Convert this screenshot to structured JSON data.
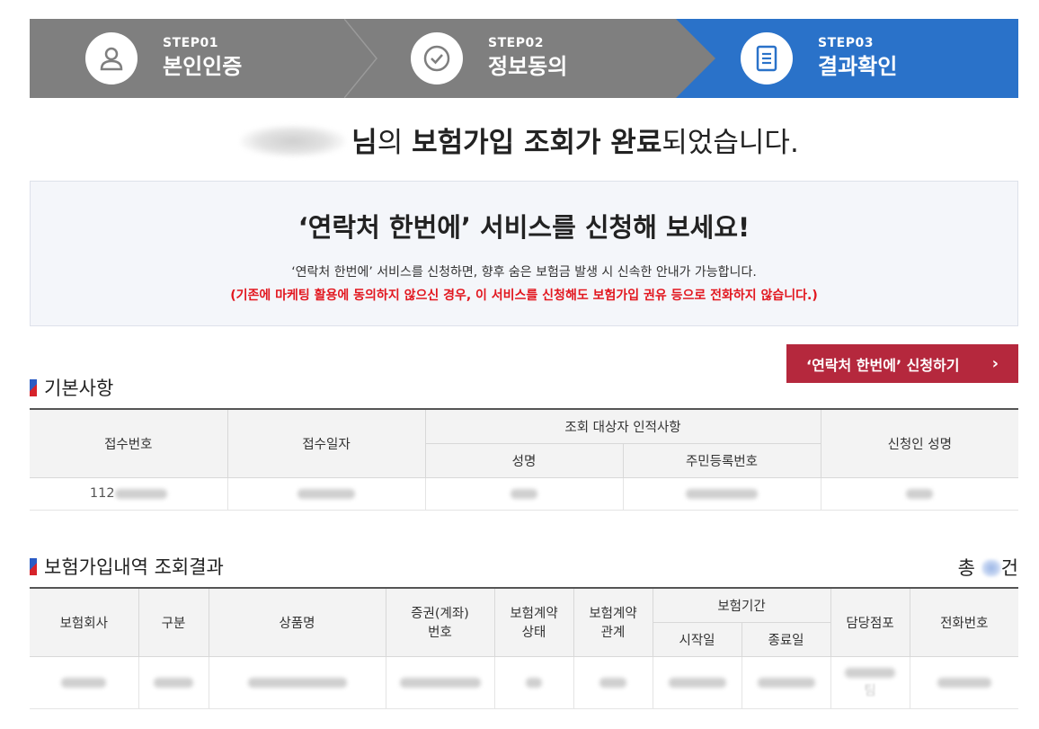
{
  "steps": [
    {
      "no": "STEP01",
      "label": "본인인증",
      "icon": "user-icon",
      "active": false
    },
    {
      "no": "STEP02",
      "label": "정보동의",
      "icon": "check-circle-icon",
      "active": false
    },
    {
      "no": "STEP03",
      "label": "결과확인",
      "icon": "document-icon",
      "active": true
    }
  ],
  "headline": {
    "suffix_1": "님",
    "suffix_2": "의 ",
    "bold": "보험가입 조회가 완료",
    "suffix_3": "되었습니다."
  },
  "banner": {
    "title": "‘연락처 한번에’ 서비스를 신청해 보세요!",
    "desc": "‘연락처 한번에’ 서비스를 신청하면, 향후 숨은 보험금 발생 시 신속한 안내가 가능합니다.",
    "warning": "(기존에 마케팅 활용에 동의하지 않으신 경우, 이 서비스를 신청해도 보험가입 권유 등으로 전화하지 않습니다.)"
  },
  "apply_button": {
    "label": "‘연락처 한번에’ 신청하기",
    "chevron": "›"
  },
  "basic_section": {
    "title": "기본사항",
    "headers": {
      "receipt_no": "접수번호",
      "receipt_date": "접수일자",
      "target_group": "조회 대상자 인적사항",
      "name": "성명",
      "rrn": "주민등록번호",
      "applicant": "신청인 성명"
    },
    "row": {
      "receipt_no_prefix": "112"
    }
  },
  "insurance_section": {
    "title": "보험가입내역 조회결과",
    "total_prefix": "총 ",
    "total_suffix": "건",
    "headers": {
      "company": "보험회사",
      "category": "구분",
      "product": "상품명",
      "policy_1": "증권(계좌)",
      "policy_2": "번호",
      "status_1": "보험계약",
      "status_2": "상태",
      "relation_1": "보험계약",
      "relation_2": "관계",
      "period": "보험기간",
      "start": "시작일",
      "end": "종료일",
      "branch": "담당점포",
      "phone": "전화번호"
    },
    "row": {
      "branch_tail": "팀"
    }
  },
  "colors": {
    "step_inactive": "#7f7f7f",
    "step_active": "#2a72c9",
    "apply_button": "#b5283d",
    "warning": "#e2171f"
  }
}
